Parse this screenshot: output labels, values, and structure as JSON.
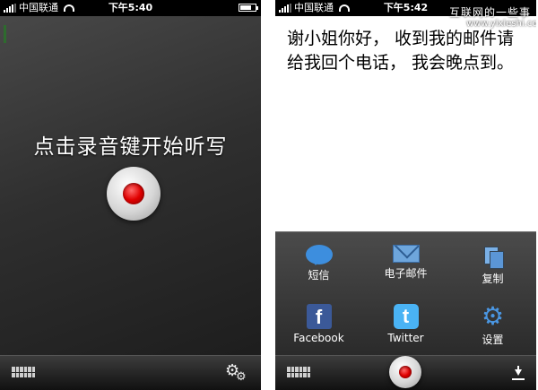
{
  "left_screen": {
    "status": {
      "carrier": "中国联通",
      "time": "下午5:40"
    },
    "prompt": "点击录音键开始听写",
    "bottom": {
      "keyboard_icon": "keyboard-icon",
      "settings_icon": "gear-icon"
    }
  },
  "right_screen": {
    "status": {
      "carrier": "中国联通",
      "time": "下午5:42"
    },
    "watermark": "互联网的一些事",
    "watermark_url": "www.yixieshi.com",
    "message": "谢小姐你好， 收到我的邮件请给我回个电话， 我会晚点到。",
    "share": [
      {
        "label": "短信",
        "icon": "sms-bubble-icon"
      },
      {
        "label": "电子邮件",
        "icon": "envelope-icon"
      },
      {
        "label": "复制",
        "icon": "copy-icon"
      },
      {
        "label": "Facebook",
        "icon": "facebook-icon",
        "glyph": "f"
      },
      {
        "label": "Twitter",
        "icon": "twitter-icon",
        "glyph": "t"
      },
      {
        "label": "设置",
        "icon": "gear-icon"
      }
    ],
    "bottom": {
      "keyboard_icon": "keyboard-icon",
      "record_icon": "record-icon",
      "download_icon": "download-icon"
    }
  },
  "colors": {
    "record_red": "#e00000",
    "share_blue": "#3d8ede",
    "facebook_blue": "#3b5998",
    "twitter_blue": "#4ab3f4"
  }
}
